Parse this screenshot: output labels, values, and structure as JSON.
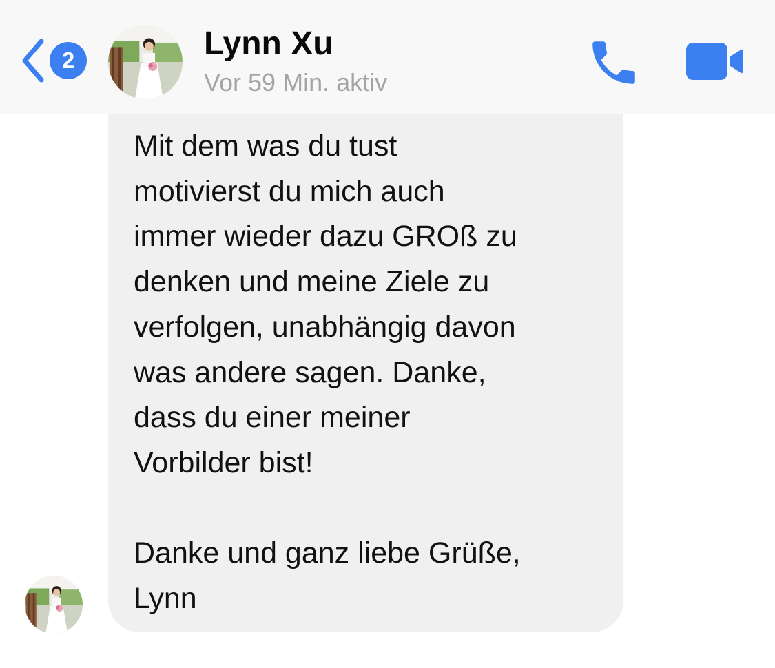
{
  "header": {
    "back": {
      "icon": "chevron-left-icon",
      "unread_count": "2"
    },
    "contact": {
      "name": "Lynn Xu",
      "status": "Vor 59 Min. aktiv",
      "avatar": "profile-photo"
    },
    "actions": {
      "call_icon": "phone-icon",
      "video_icon": "video-camera-icon"
    }
  },
  "conversation": {
    "messages": [
      {
        "sender": "Lynn Xu",
        "text": "Mit dem was du tust\nmotivierst du mich auch\nimmer wieder dazu GROß zu\ndenken und meine Ziele zu\nverfolgen, unabhängig davon\nwas andere sagen. Danke,\ndass du einer meiner\nVorbilder bist!\n\nDanke und ganz liebe Grüße,\nLynn"
      }
    ]
  },
  "colors": {
    "accent": "#3b7ff0",
    "bubble": "#f0f0f0",
    "header_background": "#f8f8f8",
    "status_text": "#a4a4a4"
  }
}
